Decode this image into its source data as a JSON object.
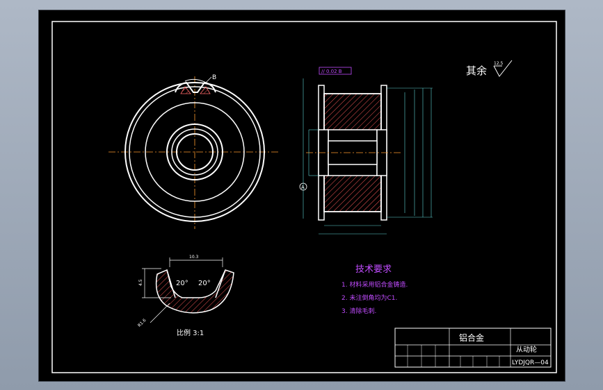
{
  "views": {
    "front_callout": "B",
    "detail_scale": "比例 3:1",
    "detail_dim_top": "10.3",
    "detail_dim_left": "4.5",
    "detail_angle_left": "20°",
    "detail_angle_right": "20°",
    "detail_radius": "R1.6"
  },
  "surface_finish": {
    "label": "其余",
    "value": "12.5"
  },
  "section_view": {
    "tolerance_frame": "// 0.02 B",
    "datum": "A"
  },
  "tech_requirements": {
    "title": "技术要求",
    "items": [
      "1. 材料采用铝合金铸造.",
      "2. 未注倒角均为C1.",
      "3. 清除毛刺."
    ]
  },
  "title_block": {
    "material": "铝合金",
    "part_name": "从动轮",
    "drawing_no": "LYDJQR—04"
  },
  "colors": {
    "drawing_bg": "#000000",
    "outline": "#ffffff",
    "annotation": "#c14cff",
    "centerline": "#ff9a2e",
    "hatch": "#ff5050",
    "dimension": "#5fd4d4"
  }
}
